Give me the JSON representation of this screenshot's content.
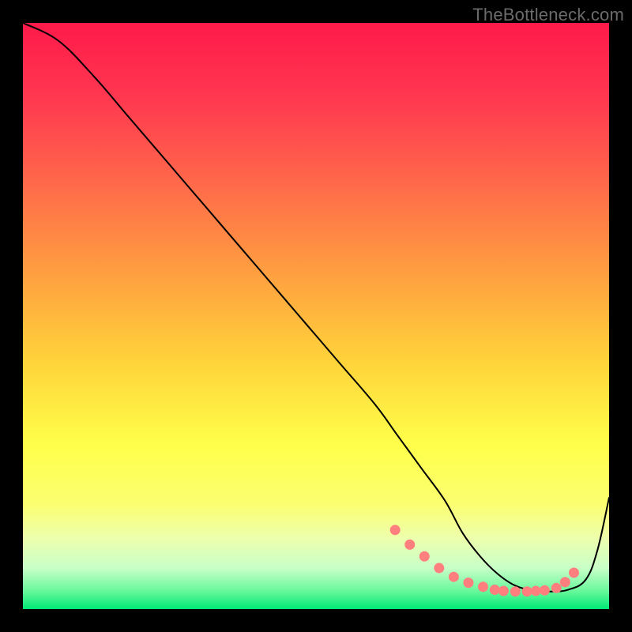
{
  "watermark": "TheBottleneck.com",
  "chart_data": {
    "type": "line",
    "title": "",
    "xlabel": "",
    "ylabel": "",
    "xlim": [
      0,
      100
    ],
    "ylim": [
      0,
      100
    ],
    "series": [
      {
        "name": "background-gradient",
        "type": "gradient",
        "stops": [
          {
            "offset": 0.0,
            "color": "#ff1a4a"
          },
          {
            "offset": 0.13,
            "color": "#ff3850"
          },
          {
            "offset": 0.28,
            "color": "#ff6b4a"
          },
          {
            "offset": 0.43,
            "color": "#ffa040"
          },
          {
            "offset": 0.58,
            "color": "#ffd43a"
          },
          {
            "offset": 0.72,
            "color": "#ffff4a"
          },
          {
            "offset": 0.82,
            "color": "#fbff70"
          },
          {
            "offset": 0.88,
            "color": "#edffad"
          },
          {
            "offset": 0.93,
            "color": "#c8ffc8"
          },
          {
            "offset": 0.97,
            "color": "#66f89a"
          },
          {
            "offset": 1.0,
            "color": "#00e876"
          }
        ]
      },
      {
        "name": "curve",
        "type": "line",
        "color": "#000000",
        "x": [
          0,
          6,
          12,
          18,
          24,
          30,
          36,
          42,
          48,
          54,
          60,
          64,
          68,
          72,
          75,
          78,
          81,
          84,
          87,
          90,
          93,
          96,
          98,
          100
        ],
        "y": [
          100,
          97,
          91,
          84,
          77,
          70,
          63,
          56,
          49,
          42,
          35,
          29.5,
          24,
          18.5,
          13,
          9,
          6,
          4,
          3.2,
          3.0,
          3.3,
          5,
          10,
          19
        ]
      },
      {
        "name": "markers",
        "type": "scatter",
        "color": "#ff7f7f",
        "x": [
          63.5,
          66,
          68.5,
          71,
          73.5,
          76,
          78.5,
          80.5,
          82,
          84,
          86,
          87.5,
          89,
          91,
          92.5,
          94
        ],
        "y": [
          13.5,
          11,
          9,
          7,
          5.5,
          4.5,
          3.8,
          3.3,
          3.1,
          3.0,
          3.0,
          3.1,
          3.2,
          3.6,
          4.6,
          6.2
        ]
      }
    ]
  },
  "layout": {
    "outer_w": 800,
    "outer_h": 800,
    "inner_x": 29,
    "inner_y": 29,
    "inner_w": 742,
    "inner_h": 742
  }
}
